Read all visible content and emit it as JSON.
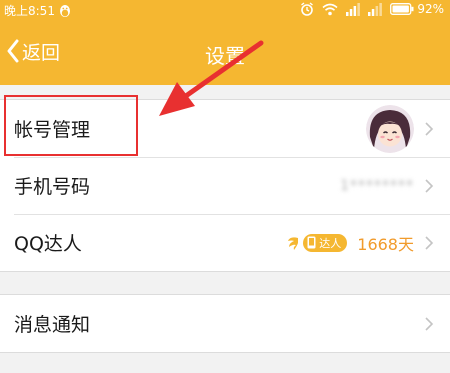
{
  "status_bar": {
    "time": "晚上8:51",
    "battery": "92%"
  },
  "nav": {
    "back_label": "返回",
    "title": "设置"
  },
  "rows": [
    {
      "label": "帐号管理"
    },
    {
      "label": "手机号码",
      "value": "1********"
    },
    {
      "label": "QQ达人",
      "badge": "达人",
      "days": "1668天"
    },
    {
      "label": "消息通知"
    }
  ],
  "colors": {
    "accent": "#f5b731",
    "highlight": "#e83030",
    "days_text": "#f19b2c"
  }
}
